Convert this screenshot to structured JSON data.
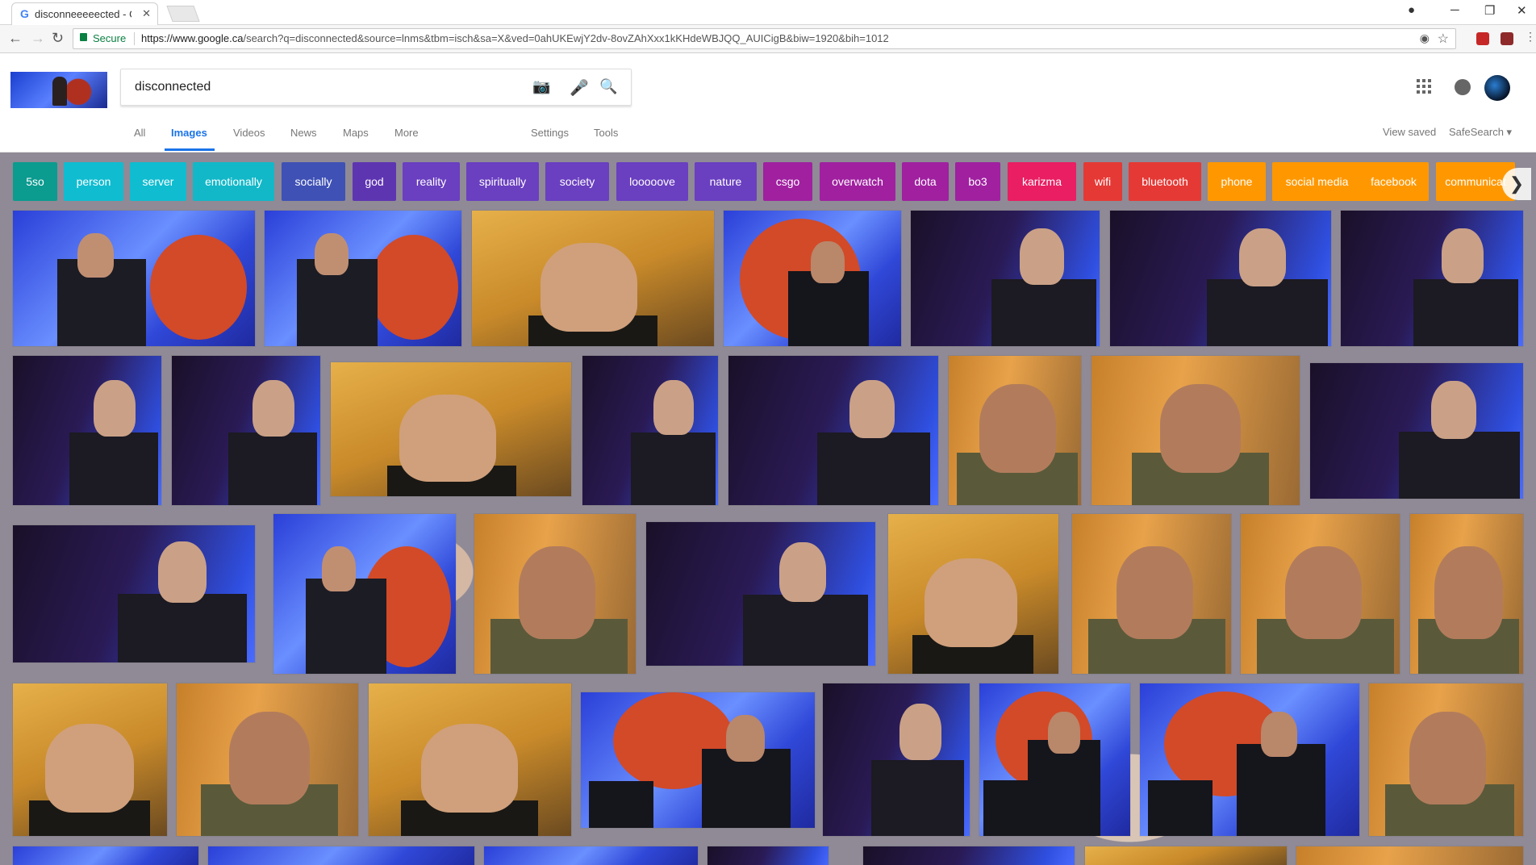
{
  "browser": {
    "tab_title": "disconneeeeected - Goo",
    "tab_close": "✕",
    "secure_label": "Secure",
    "url_host": "https://www.google.ca",
    "url_path": "/search?q=disconnected&source=lnms&tbm=isch&sa=X&ved=0ahUKEwjY2dv-8ovZAhXxx1kKHdeWBJQQ_AUICigB&biw=1920&bih=1012",
    "controls": {
      "minimize": "─",
      "restore": "❐",
      "close": "✕"
    }
  },
  "search": {
    "query": "disconnected"
  },
  "nav_tabs": [
    {
      "label": "All"
    },
    {
      "label": "Images"
    },
    {
      "label": "Videos"
    },
    {
      "label": "News"
    },
    {
      "label": "Maps"
    },
    {
      "label": "More"
    },
    {
      "label": "Settings"
    },
    {
      "label": "Tools"
    }
  ],
  "right_links": {
    "view_saved": "View saved",
    "safesearch": "SafeSearch ▾"
  },
  "chips": [
    {
      "label": "5so",
      "color": "#0b9b8f"
    },
    {
      "label": "person",
      "color": "#10bcd0"
    },
    {
      "label": "server",
      "color": "#10bcd0"
    },
    {
      "label": "emotionally",
      "color": "#12b8c8"
    },
    {
      "label": "socially",
      "color": "#3f51b5"
    },
    {
      "label": "god",
      "color": "#5e35b1"
    },
    {
      "label": "reality",
      "color": "#6a3fc0"
    },
    {
      "label": "spiritually",
      "color": "#6a3fc0"
    },
    {
      "label": "society",
      "color": "#6a3fc0"
    },
    {
      "label": "looooove",
      "color": "#6a3fc0"
    },
    {
      "label": "nature",
      "color": "#6a3fc0"
    },
    {
      "label": "csgo",
      "color": "#a020a0"
    },
    {
      "label": "overwatch",
      "color": "#a020a0"
    },
    {
      "label": "dota",
      "color": "#a020a0"
    },
    {
      "label": "bo3",
      "color": "#a020a0"
    },
    {
      "label": "karizma",
      "color": "#e91e63"
    },
    {
      "label": "wifi",
      "color": "#e53935"
    },
    {
      "label": "bluetooth",
      "color": "#e53935"
    },
    {
      "label": "phone",
      "color": "#ff9800"
    },
    {
      "label": "social media",
      "color": "#ff9800"
    },
    {
      "label": "facebook",
      "color": "#ff9800"
    },
    {
      "label": "communicat",
      "color": "#ff9800"
    }
  ],
  "icons": {
    "back": "←",
    "forward": "→",
    "reload": "↻",
    "star": "☆",
    "camera": "📷",
    "mic": "🎤",
    "search": "🔍",
    "chip_next": "❯"
  }
}
